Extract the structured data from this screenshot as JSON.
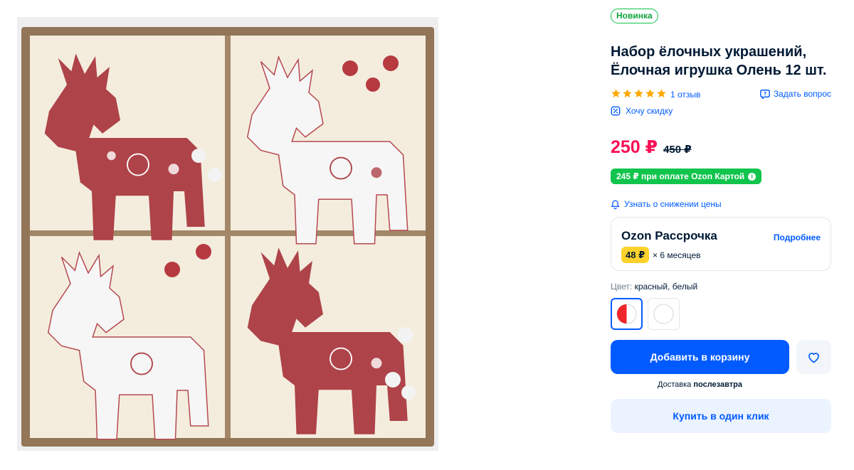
{
  "product": {
    "badge": "Новинка",
    "title": "Набор ёлочных украшений, Ёлочная игрушка Олень 12 шт.",
    "rating_stars": 5,
    "reviews": "1 отзыв",
    "ask_question": "Задать вопрос",
    "want_discount": "Хочу скидку",
    "price": "250 ₽",
    "old_price": "450 ₽",
    "card_price": "245 ₽ при оплате Ozon Картой",
    "price_alert": "Узнать о снижении цены"
  },
  "installment": {
    "title": "Ozon Рассрочка",
    "more": "Подробнее",
    "amount": "48 ₽",
    "months": "× 6 месяцев"
  },
  "color": {
    "label": "Цвет:",
    "value": "красный, белый"
  },
  "actions": {
    "add_to_cart": "Добавить в корзину",
    "delivery_prefix": "Доставка",
    "delivery_day": "послезавтра",
    "buy_one_click": "Купить в один клик"
  },
  "colors": {
    "accent": "#005bff",
    "price": "#f91155",
    "green": "#10c44c",
    "star": "#ffa800",
    "installment_badge": "#ffd22b"
  },
  "icons": [
    "star-icon",
    "question-icon",
    "discount-icon",
    "bell-icon",
    "info-icon",
    "heart-icon"
  ]
}
